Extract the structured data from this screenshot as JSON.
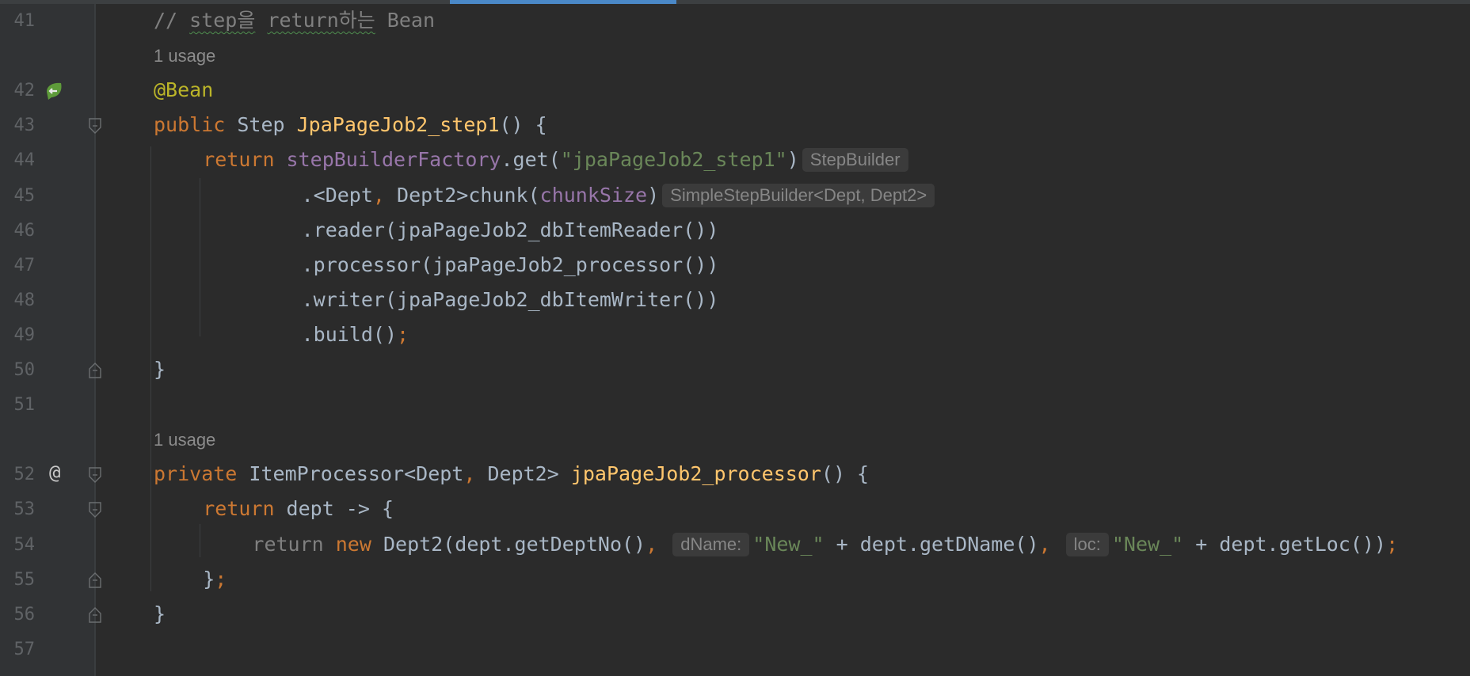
{
  "scroll": {
    "indicator_color": "#4a88c7"
  },
  "lines": [
    {
      "num": "41",
      "tokens": [
        {
          "t": "// ",
          "c": "cmt"
        },
        {
          "t": "step을",
          "c": "cmt squig"
        },
        {
          "t": " ",
          "c": "cmt"
        },
        {
          "t": "return하는",
          "c": "cmt squig"
        },
        {
          "t": " Bean",
          "c": "cmt"
        }
      ]
    },
    {
      "usage": "1 usage"
    },
    {
      "num": "42",
      "gutter_icon": "spring-bean-icon",
      "tokens": [
        {
          "t": "@Bean",
          "c": "ann"
        }
      ]
    },
    {
      "num": "43",
      "fold": "open",
      "tokens": [
        {
          "t": "public ",
          "c": "kw"
        },
        {
          "t": "Step ",
          "c": "def"
        },
        {
          "t": "JpaPageJob2_step1",
          "c": "fn"
        },
        {
          "t": "() {",
          "c": "def"
        }
      ]
    },
    {
      "num": "44",
      "indent": 2,
      "tokens": [
        {
          "t": "return ",
          "c": "kw"
        },
        {
          "t": "stepBuilderFactory",
          "c": "fld"
        },
        {
          "t": ".get(",
          "c": "def"
        },
        {
          "t": "\"jpaPageJob2_step1\"",
          "c": "str"
        },
        {
          "t": ")",
          "c": "def"
        },
        {
          "hint": "StepBuilder"
        }
      ]
    },
    {
      "num": "45",
      "indent": 6,
      "tokens": [
        {
          "t": ".<Dept",
          "c": "def"
        },
        {
          "t": ", ",
          "c": "kw"
        },
        {
          "t": "Dept2>chunk(",
          "c": "def"
        },
        {
          "t": "chunkSize",
          "c": "fld"
        },
        {
          "t": ")",
          "c": "def"
        },
        {
          "hint": "SimpleStepBuilder<Dept, Dept2>"
        }
      ]
    },
    {
      "num": "46",
      "indent": 6,
      "tokens": [
        {
          "t": ".reader(jpaPageJob2_dbItemReader())",
          "c": "def"
        }
      ]
    },
    {
      "num": "47",
      "indent": 6,
      "tokens": [
        {
          "t": ".processor(jpaPageJob2_processor())",
          "c": "def"
        }
      ]
    },
    {
      "num": "48",
      "indent": 6,
      "tokens": [
        {
          "t": ".writer(jpaPageJob2_dbItemWriter())",
          "c": "def"
        }
      ]
    },
    {
      "num": "49",
      "indent": 6,
      "tokens": [
        {
          "t": ".build()",
          "c": "def"
        },
        {
          "t": ";",
          "c": "kw"
        }
      ]
    },
    {
      "num": "50",
      "fold": "close",
      "tokens": [
        {
          "t": "}",
          "c": "def"
        }
      ]
    },
    {
      "num": "51",
      "tokens": []
    },
    {
      "usage": "1 usage"
    },
    {
      "num": "52",
      "gutter_icon": "at-sign-icon",
      "gutter_text": "@",
      "fold": "open",
      "tokens": [
        {
          "t": "private ",
          "c": "kw"
        },
        {
          "t": "ItemProcessor<Dept",
          "c": "def"
        },
        {
          "t": ", ",
          "c": "kw"
        },
        {
          "t": "Dept2> ",
          "c": "def"
        },
        {
          "t": "jpaPageJob2_processor",
          "c": "fn"
        },
        {
          "t": "() {",
          "c": "def"
        }
      ]
    },
    {
      "num": "53",
      "indent": 2,
      "fold": "open",
      "tokens": [
        {
          "t": "return ",
          "c": "kw"
        },
        {
          "t": "dept -> {",
          "c": "def"
        }
      ]
    },
    {
      "num": "54",
      "indent": 4,
      "tokens": [
        {
          "t": "return ",
          "c": "cmt"
        },
        {
          "t": "new ",
          "c": "kw"
        },
        {
          "t": "Dept2(dept.getDeptNo()",
          "c": "def"
        },
        {
          "t": ", ",
          "c": "kw"
        },
        {
          "hint": "dName:"
        },
        {
          "t": "\"New_\"",
          "c": "str"
        },
        {
          "t": " + dept.getDName()",
          "c": "def"
        },
        {
          "t": ", ",
          "c": "kw"
        },
        {
          "hint": "loc:"
        },
        {
          "t": "\"New_\"",
          "c": "str"
        },
        {
          "t": " + dept.getLoc())",
          "c": "def"
        },
        {
          "t": ";",
          "c": "kw"
        }
      ]
    },
    {
      "num": "55",
      "indent": 2,
      "fold": "close",
      "tokens": [
        {
          "t": "}",
          "c": "def"
        },
        {
          "t": ";",
          "c": "kw"
        }
      ]
    },
    {
      "num": "56",
      "fold": "close",
      "tokens": [
        {
          "t": "}",
          "c": "def"
        }
      ]
    },
    {
      "num": "57",
      "tokens": []
    }
  ]
}
